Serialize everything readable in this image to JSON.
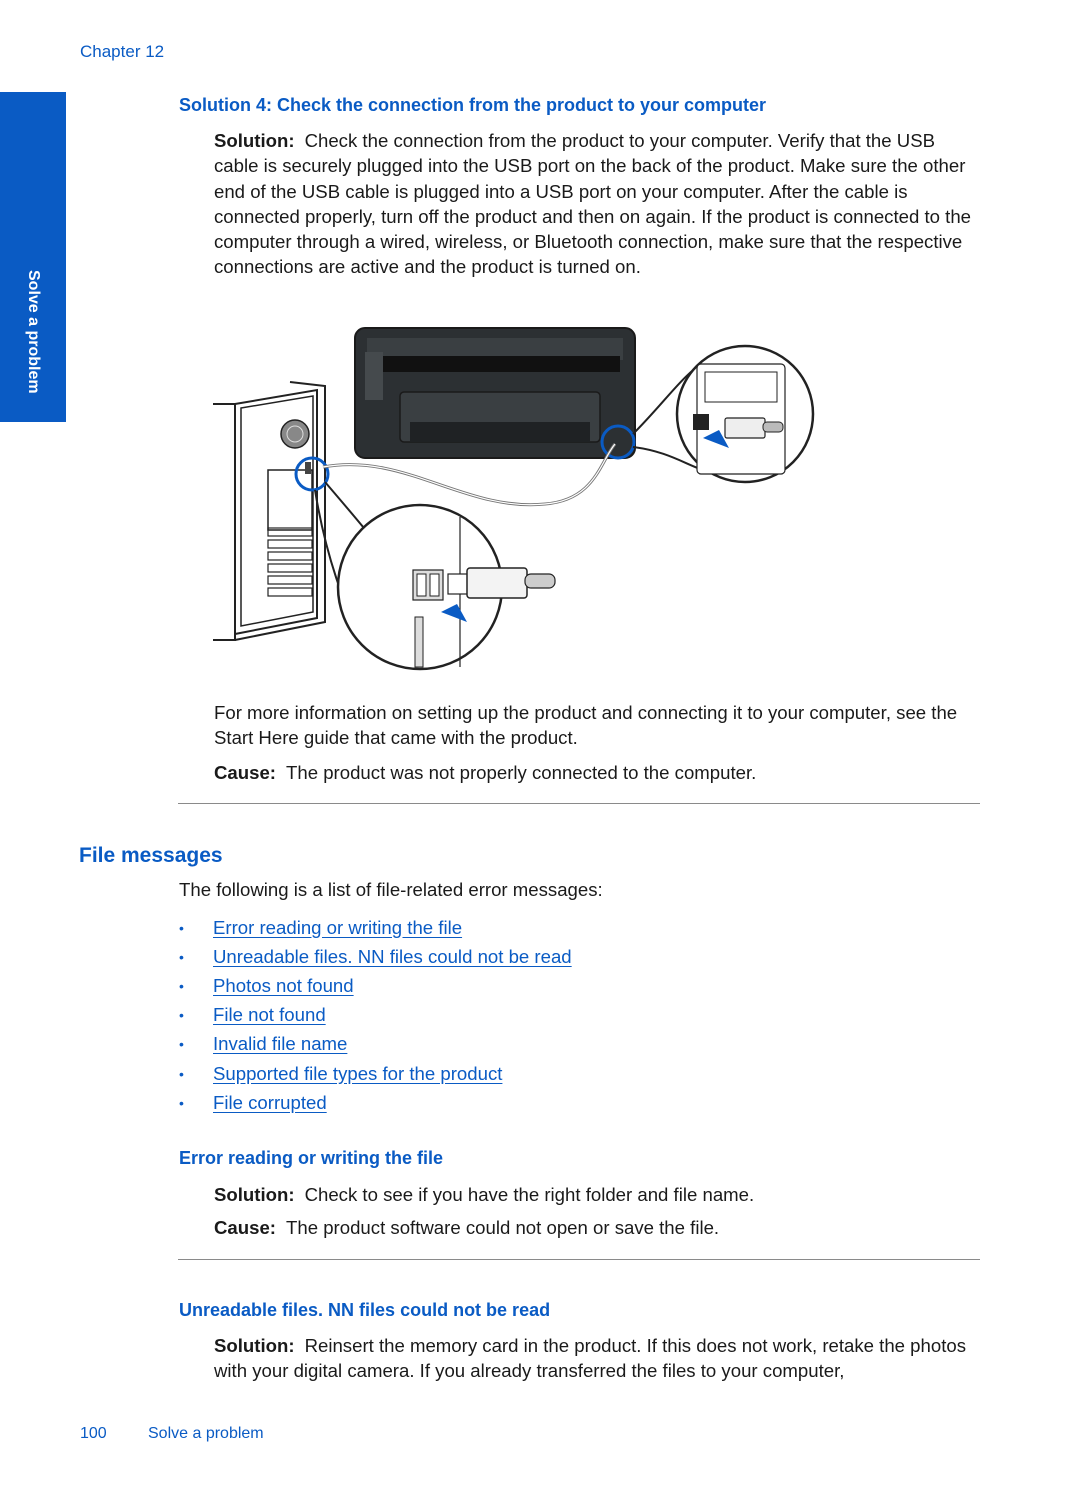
{
  "header": {
    "chapter": "Chapter 12"
  },
  "side_tab": {
    "label": "Solve a problem",
    "color": "#0a5bc4"
  },
  "solution4": {
    "heading": "Solution 4: Check the connection from the product to your computer",
    "solution_label": "Solution:",
    "solution_text": "Check the connection from the product to your computer. Verify that the USB cable is securely plugged into the USB port on the back of the product. Make sure the other end of the USB cable is plugged into a USB port on your computer. After the cable is connected properly, turn off the product and then on again. If the product is connected to the computer through a wired, wireless, or Bluetooth connection, make sure that the respective connections are active and the product is turned on.",
    "illustration": "usb-connection-diagram",
    "more_info": "For more information on setting up the product and connecting it to your computer, see the Start Here guide that came with the product.",
    "cause_label": "Cause:",
    "cause_text": "The product was not properly connected to the computer."
  },
  "file_messages": {
    "heading": "File messages",
    "intro": "The following is a list of file-related error messages:",
    "links": [
      "Error reading or writing the file",
      "Unreadable files. NN files could not be read",
      "Photos not found",
      "File not found",
      "Invalid file name",
      "Supported file types for the product",
      "File corrupted"
    ]
  },
  "error_reading": {
    "heading": "Error reading or writing the file",
    "solution_label": "Solution:",
    "solution_text": "Check to see if you have the right folder and file name.",
    "cause_label": "Cause:",
    "cause_text": "The product software could not open or save the file."
  },
  "unreadable": {
    "heading": "Unreadable files. NN files could not be read",
    "solution_label": "Solution:",
    "solution_text": "Reinsert the memory card in the product. If this does not work, retake the photos with your digital camera. If you already transferred the files to your computer,"
  },
  "footer": {
    "page_number": "100",
    "section": "Solve a problem"
  },
  "colors": {
    "accent": "#0a5bc4",
    "text": "#1a1a1a",
    "rule": "#8a8a8a"
  }
}
